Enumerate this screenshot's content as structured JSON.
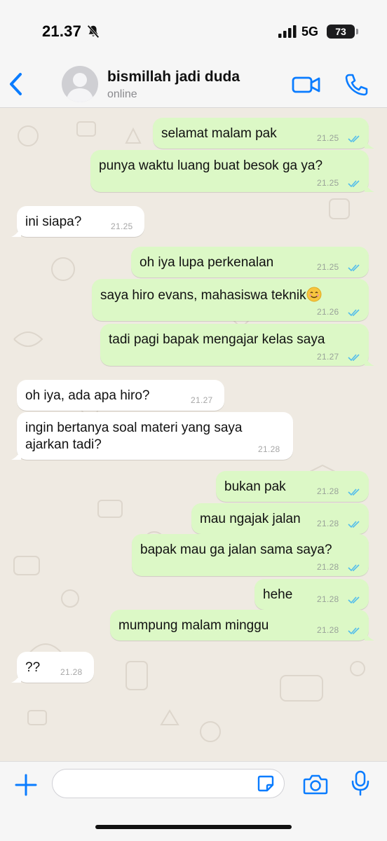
{
  "status_bar": {
    "time": "21.37",
    "network": "5G",
    "battery": "73"
  },
  "header": {
    "contact_name": "bismillah jadi duda",
    "contact_status": "online"
  },
  "messages": [
    {
      "dir": "out",
      "text": "selamat malam pak",
      "time": "21.25"
    },
    {
      "dir": "out",
      "text": "punya waktu luang buat besok ga ya?",
      "time": "21.25"
    },
    {
      "dir": "in",
      "text": "ini siapa?",
      "time": "21.25"
    },
    {
      "dir": "out",
      "text": "oh iya lupa perkenalan",
      "time": "21.25"
    },
    {
      "dir": "out",
      "text": "saya hiro evans, mahasiswa teknik",
      "time": "21.26"
    },
    {
      "dir": "out",
      "text": "tadi pagi bapak mengajar kelas saya",
      "time": "21.27"
    },
    {
      "dir": "in",
      "text": "oh iya, ada apa hiro?",
      "time": "21.27"
    },
    {
      "dir": "in",
      "text": "ingin bertanya soal materi yang saya ajarkan tadi?",
      "time": "21.28"
    },
    {
      "dir": "out",
      "text": "bukan pak",
      "time": "21.28"
    },
    {
      "dir": "out",
      "text": "mau ngajak jalan",
      "time": "21.28"
    },
    {
      "dir": "out",
      "text": "bapak mau ga jalan sama saya?",
      "time": "21.28"
    },
    {
      "dir": "out",
      "text": "hehe",
      "time": "21.28"
    },
    {
      "dir": "out",
      "text": "mumpung malam minggu",
      "time": "21.28"
    },
    {
      "dir": "in",
      "text": "??",
      "time": "21.28"
    }
  ],
  "input": {
    "placeholder": ""
  },
  "colors": {
    "accent": "#0a7cff",
    "bubble_out": "#dcf8c6",
    "bubble_in": "#ffffff",
    "chat_bg": "#efeae2",
    "read_ticks": "#53bdeb"
  },
  "icons": {
    "back": "chevron-left-icon",
    "video": "video-camera-icon",
    "call": "phone-icon",
    "plus": "plus-icon",
    "sticker": "sticker-icon",
    "camera": "camera-icon",
    "mic": "microphone-icon",
    "mute": "bell-slash-icon",
    "emoji": "smiling-face-emoji"
  }
}
